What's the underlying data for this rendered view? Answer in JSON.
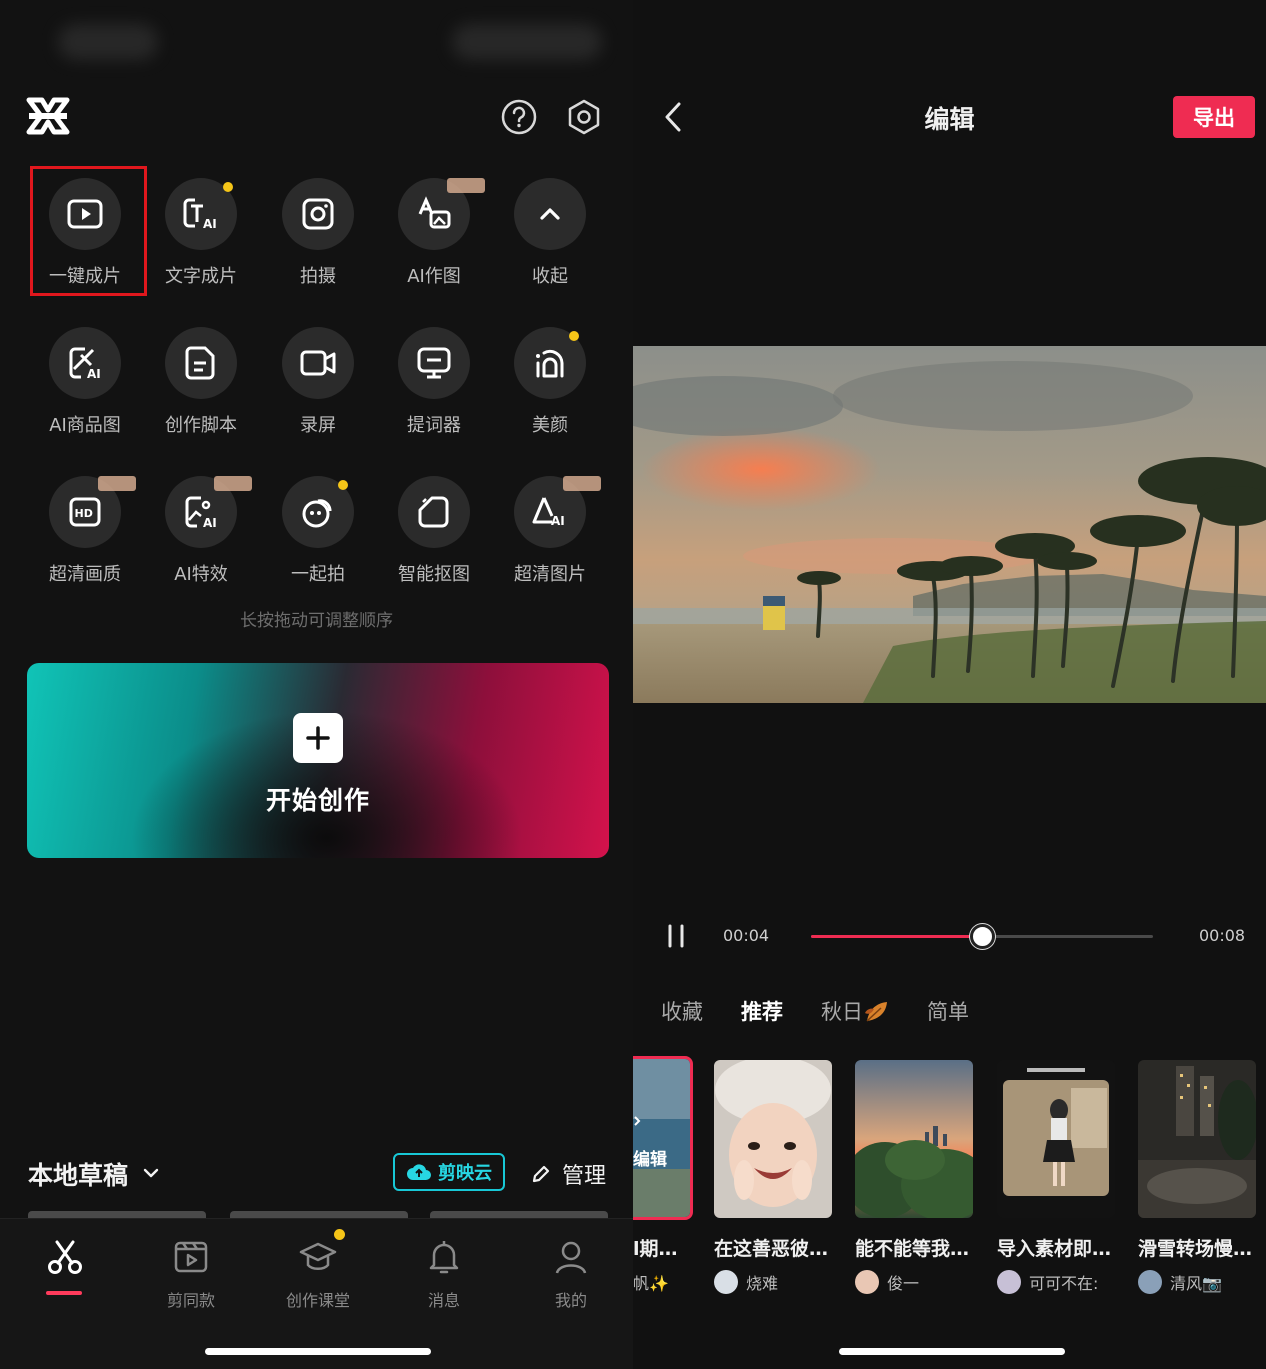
{
  "home": {
    "tools": [
      {
        "label": "一键成片",
        "icon": "play-square-icon"
      },
      {
        "label": "文字成片",
        "icon": "text-ai-icon"
      },
      {
        "label": "拍摄",
        "icon": "camera-icon"
      },
      {
        "label": "AI作图",
        "icon": "ai-image-icon"
      },
      {
        "label": "收起",
        "icon": "chevron-up-icon"
      },
      {
        "label": "AI商品图",
        "icon": "ai-product-icon"
      },
      {
        "label": "创作脚本",
        "icon": "script-icon"
      },
      {
        "label": "录屏",
        "icon": "screen-record-icon"
      },
      {
        "label": "提词器",
        "icon": "teleprompter-icon"
      },
      {
        "label": "美颜",
        "icon": "beauty-icon"
      },
      {
        "label": "超清画质",
        "icon": "hd-icon"
      },
      {
        "label": "AI特效",
        "icon": "ai-effect-icon"
      },
      {
        "label": "一起拍",
        "icon": "shoot-together-icon"
      },
      {
        "label": "智能抠图",
        "icon": "cutout-icon"
      },
      {
        "label": "超清图片",
        "icon": "hd-image-icon"
      }
    ],
    "hint": "长按拖动可调整顺序",
    "create_label": "开始创作",
    "drafts_title": "本地草稿",
    "cloud_label": "剪映云",
    "manage_label": "管理",
    "tabs": [
      {
        "label": "",
        "icon": "scissors-icon"
      },
      {
        "label": "剪同款",
        "icon": "template-icon"
      },
      {
        "label": "创作课堂",
        "icon": "graduation-cap-icon"
      },
      {
        "label": "消息",
        "icon": "bell-icon"
      },
      {
        "label": "我的",
        "icon": "user-icon"
      }
    ],
    "colors": {
      "accent": "#ef2c52",
      "badge": "#f5c518",
      "cloud": "#18c8d6"
    }
  },
  "editor": {
    "title": "编辑",
    "export_label": "导出",
    "time_current": "00:04",
    "time_total": "00:08",
    "progress": 0.5,
    "template_tabs": [
      "收藏",
      "推荐",
      "秋日",
      "简单"
    ],
    "first_card": {
      "title": "l期…",
      "author": "帆✨",
      "overlay": "编辑"
    },
    "cards": [
      {
        "title": "在这善恶彼…",
        "author": "烧难"
      },
      {
        "title": "能不能等我…",
        "author": "俊一"
      },
      {
        "title": "导入素材即…",
        "author": "可可不在:"
      },
      {
        "title": "滑雪转场慢…",
        "author": "清风📷"
      }
    ]
  }
}
